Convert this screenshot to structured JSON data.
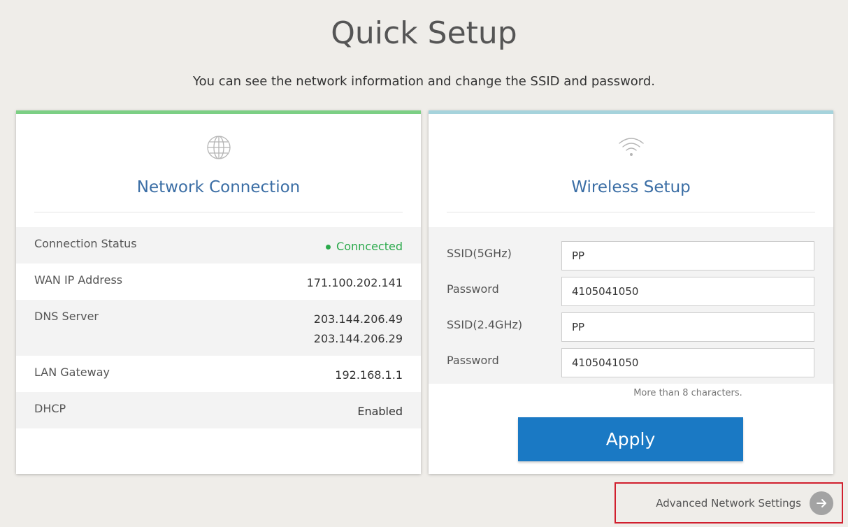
{
  "header": {
    "title": "Quick Setup",
    "subtitle": "You can see the network information and change the SSID and password."
  },
  "network": {
    "icon": "globe-icon",
    "title": "Network Connection",
    "accent_color": "#7ccf84",
    "rows": [
      {
        "label": "Connection Status",
        "value": "Conncected",
        "status_color": "#2aa94b"
      },
      {
        "label": "WAN IP Address",
        "value": "171.100.202.141"
      },
      {
        "label": "DNS Server",
        "value": "203.144.206.49",
        "value2": "203.144.206.29"
      },
      {
        "label": "LAN Gateway",
        "value": "192.168.1.1"
      },
      {
        "label": "DHCP",
        "value": "Enabled"
      }
    ]
  },
  "wireless": {
    "icon": "wifi-icon",
    "title": "Wireless Setup",
    "accent_color": "#a6d3dc",
    "fields": [
      {
        "label": "SSID(5GHz)",
        "value": "PP"
      },
      {
        "label": "Password",
        "value": "4105041050"
      },
      {
        "label": "SSID(2.4GHz)",
        "value": "PP"
      },
      {
        "label": "Password",
        "value": "4105041050"
      }
    ],
    "hint": "More than 8 characters.",
    "apply_label": "Apply",
    "apply_color": "#1a79c4"
  },
  "footer": {
    "advanced_label": "Advanced Network Settings",
    "arrow_icon": "arrow-right-icon"
  }
}
